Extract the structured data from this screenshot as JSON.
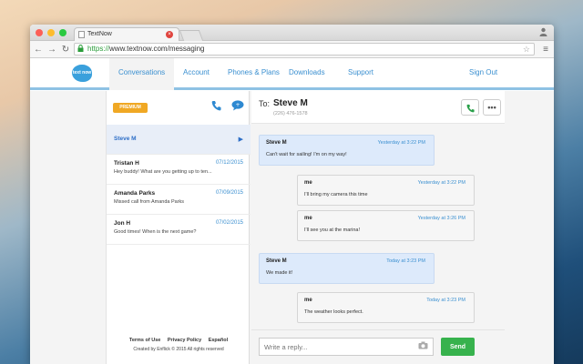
{
  "browser": {
    "tab_title": "TextNow",
    "tab_close": "×",
    "url_scheme": "https://",
    "url_rest": "www.textnow.com/messaging",
    "back": "←",
    "forward": "→",
    "reload": "↻",
    "menu": "≡",
    "star": "☆"
  },
  "nav": {
    "logo_text": "text now",
    "items": [
      "Conversations",
      "Account",
      "Phones & Plans",
      "Downloads",
      "Support"
    ],
    "signout": "Sign Out"
  },
  "sidebar": {
    "premium": "PREMIUM",
    "conversations": [
      {
        "name": "Steve M",
        "date": "",
        "snippet": ""
      },
      {
        "name": "Tristan H",
        "date": "07/12/2015",
        "snippet": "Hey buddy! What are you getting up to ten..."
      },
      {
        "name": "Amanda Parks",
        "date": "07/09/2015",
        "snippet": "Missed call from Amanda Parks"
      },
      {
        "name": "Jon H",
        "date": "07/02/2015",
        "snippet": "Good times! When is the next game?"
      }
    ],
    "footer_links": [
      "Terms of Use",
      "Privacy Policy",
      "Español"
    ],
    "credit": "Created by Enflick © 2015 All rights reserved"
  },
  "chat": {
    "to_label": "To:",
    "contact_name": "Steve M",
    "contact_number": "(226) 476-1578",
    "more": "•••",
    "messages": [
      {
        "sender": "Steve M",
        "time": "Yesterday at 3:22 PM",
        "text": "Can't wait for sailing! I'm on my way!",
        "direction": "in"
      },
      {
        "sender": "me",
        "time": "Yesterday at 3:22 PM",
        "text": "I'll bring my camera this time",
        "direction": "out"
      },
      {
        "sender": "me",
        "time": "Yesterday at 3:26 PM",
        "text": "I'll see you at the marina!",
        "direction": "out"
      },
      {
        "sender": "Steve M",
        "time": "Today at 3:23 PM",
        "text": "We made it!",
        "direction": "in"
      },
      {
        "sender": "me",
        "time": "Today at 3:23 PM",
        "text": "The weather looks perfect.",
        "direction": "out"
      }
    ],
    "reply_placeholder": "Write a reply...",
    "send_label": "Send"
  },
  "colors": {
    "accent": "#3a8fd0",
    "premium": "#f0a824",
    "send": "#37b24d",
    "incoming_bubble": "#ddeafb"
  }
}
